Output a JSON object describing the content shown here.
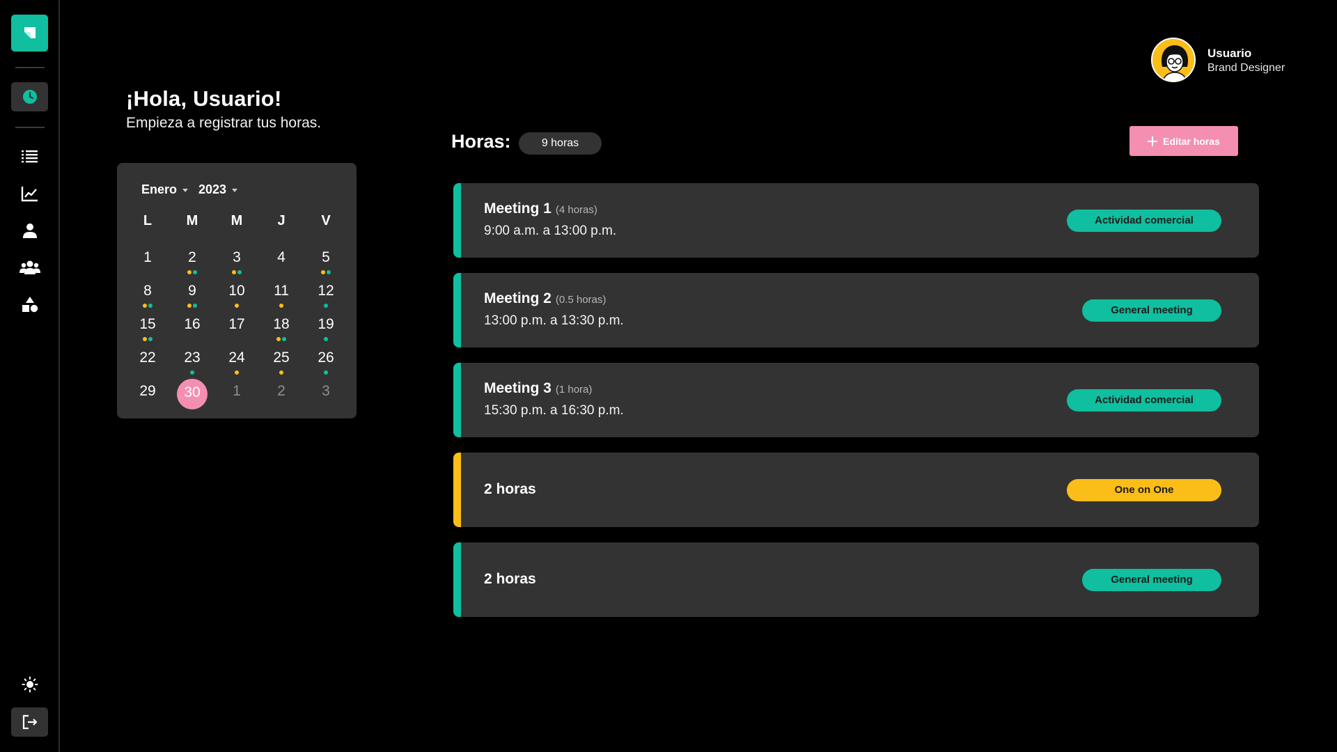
{
  "sidebar": {
    "logo": "app-logo",
    "nav": [
      {
        "icon": "clock-icon",
        "active": true
      },
      {
        "icon": "list-icon",
        "active": false
      },
      {
        "icon": "chart-icon",
        "active": false
      },
      {
        "icon": "user-icon",
        "active": false
      },
      {
        "icon": "group-icon",
        "active": false
      },
      {
        "icon": "shapes-icon",
        "active": false
      }
    ],
    "bottom": [
      {
        "icon": "sun-icon"
      },
      {
        "icon": "logout-icon"
      }
    ]
  },
  "greeting": {
    "title": "¡Hola, Usuario!",
    "subtitle": "Empieza a registrar tus horas."
  },
  "calendar": {
    "month": "Enero",
    "year": "2023",
    "weekdays": [
      "L",
      "M",
      "M",
      "J",
      "V"
    ],
    "weeks": [
      [
        {
          "d": "1",
          "dots": []
        },
        {
          "d": "2",
          "dots": [
            "#fbbd17",
            "#0fbf9f"
          ]
        },
        {
          "d": "3",
          "dots": [
            "#fbbd17",
            "#0fbf9f"
          ]
        },
        {
          "d": "4",
          "dots": []
        },
        {
          "d": "5",
          "dots": [
            "#fbbd17",
            "#0fbf9f"
          ]
        }
      ],
      [
        {
          "d": "8",
          "dots": [
            "#fbbd17",
            "#0fbf9f"
          ]
        },
        {
          "d": "9",
          "dots": [
            "#fbbd17",
            "#0fbf9f"
          ]
        },
        {
          "d": "10",
          "dots": [
            "#fbbd17"
          ]
        },
        {
          "d": "11",
          "dots": [
            "#fbbd17"
          ]
        },
        {
          "d": "12",
          "dots": [
            "#0fbf9f"
          ]
        }
      ],
      [
        {
          "d": "15",
          "dots": [
            "#fbbd17",
            "#0fbf9f"
          ]
        },
        {
          "d": "16",
          "dots": []
        },
        {
          "d": "17",
          "dots": []
        },
        {
          "d": "18",
          "dots": [
            "#fbbd17",
            "#0fbf9f"
          ]
        },
        {
          "d": "19",
          "dots": [
            "#0fbf9f"
          ]
        }
      ],
      [
        {
          "d": "22",
          "dots": []
        },
        {
          "d": "23",
          "dots": [
            "#0fbf9f"
          ]
        },
        {
          "d": "24",
          "dots": [
            "#fbbd17"
          ]
        },
        {
          "d": "25",
          "dots": [
            "#fbbd17"
          ]
        },
        {
          "d": "26",
          "dots": [
            "#0fbf9f"
          ]
        }
      ],
      [
        {
          "d": "29",
          "dots": []
        },
        {
          "d": "30",
          "dots": [],
          "selected": true
        },
        {
          "d": "1",
          "dots": [],
          "muted": true
        },
        {
          "d": "2",
          "dots": [],
          "muted": true
        },
        {
          "d": "3",
          "dots": [],
          "muted": true
        }
      ]
    ]
  },
  "hours": {
    "title": "Horas:",
    "total": "9 horas",
    "edit_label": "Editar horas"
  },
  "user": {
    "name": "Usuario",
    "role": "Brand Designer"
  },
  "colors": {
    "teal": "#0fbf9f",
    "yellow": "#fbbd17",
    "pink": "#f48fb1"
  },
  "events": [
    {
      "title": "Meeting 1",
      "duration": "(4 horas)",
      "time": "9:00 a.m. a 13:00 p.m.",
      "tag": "Actividad comercial",
      "color": "#0fbf9f"
    },
    {
      "title": "Meeting 2",
      "duration": "(0.5 horas)",
      "time": "13:00 p.m. a 13:30 p.m.",
      "tag": "General meeting",
      "color": "#0fbf9f"
    },
    {
      "title": "Meeting 3",
      "duration": "(1 hora)",
      "time": "15:30 p.m. a 16:30 p.m.",
      "tag": "Actividad comercial",
      "color": "#0fbf9f"
    },
    {
      "title": "2 horas",
      "duration": "",
      "time": "",
      "tag": "One on One",
      "color": "#fbbd17"
    },
    {
      "title": "2 horas",
      "duration": "",
      "time": "",
      "tag": "General meeting",
      "color": "#0fbf9f"
    }
  ]
}
